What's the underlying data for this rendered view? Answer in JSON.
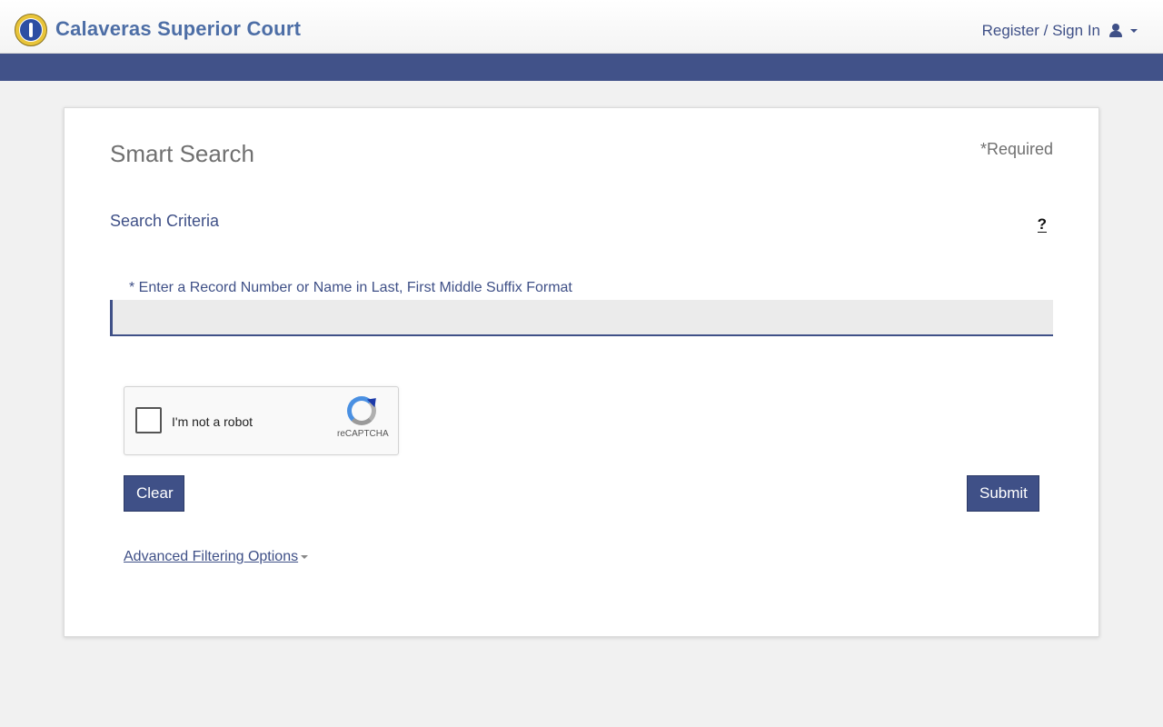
{
  "header": {
    "brand": "Calaveras Superior Court",
    "signin_label": "Register / Sign In",
    "logo_icon": "court-seal-icon",
    "user_icon": "user-icon",
    "caret_icon": "chevron-down-icon"
  },
  "search": {
    "title": "Smart Search",
    "required_note": "*Required",
    "criteria_heading": "Search Criteria",
    "help_label": "?",
    "field_label": "* Enter a Record Number or Name in Last, First Middle Suffix Format",
    "input_value": "",
    "placeholder": ""
  },
  "captcha": {
    "label": "I'm not a robot",
    "brand": "reCAPTCHA",
    "checked": false
  },
  "actions": {
    "clear_label": "Clear",
    "submit_label": "Submit"
  },
  "advanced": {
    "label": "Advanced Filtering Options"
  },
  "colors": {
    "accent": "#3f5087",
    "brand": "#4d6ea6",
    "background": "#f1f1f1"
  }
}
